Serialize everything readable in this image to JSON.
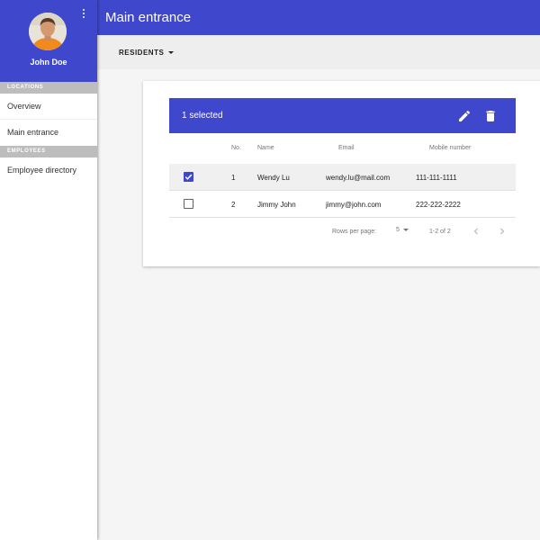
{
  "sidebar": {
    "user_name": "John Doe",
    "sections": [
      {
        "header": "LOCATIONS",
        "items": [
          "Overview",
          "Main entrance"
        ]
      },
      {
        "header": "EMPLOYEES",
        "items": [
          "Employee directory"
        ]
      }
    ]
  },
  "appbar": {
    "title": "Main entrance"
  },
  "toolbar": {
    "residents_label": "RESIDENTS"
  },
  "table": {
    "selected_text": "1 selected",
    "columns": [
      "No.",
      "Name",
      "Email",
      "Mobile number"
    ],
    "rows": [
      {
        "checked": true,
        "no": "1",
        "name": "Wendy Lu",
        "email": "wendy.lu@mail.com",
        "mobile": "111-111-1111"
      },
      {
        "checked": false,
        "no": "2",
        "name": "Jimmy John",
        "email": "jimmy@john.com",
        "mobile": "222-222-2222"
      }
    ],
    "footer": {
      "rows_per_page_label": "Rows per page:",
      "rows_per_page_value": "5",
      "range_text": "1-2 of 2"
    }
  },
  "colors": {
    "primary": "#3f48cc",
    "section_header": "#bdbdbd"
  },
  "icons": [
    "more-vert-icon",
    "edit-icon",
    "delete-icon",
    "check-icon",
    "arrow-drop-down-icon",
    "chevron-left-icon",
    "chevron-right-icon"
  ]
}
